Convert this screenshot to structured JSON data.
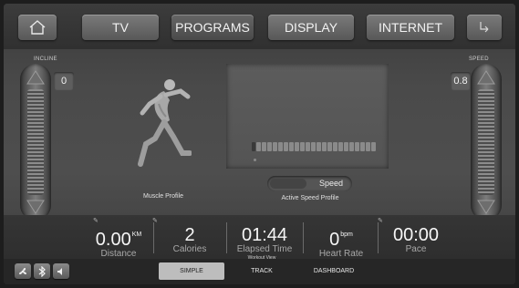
{
  "nav": {
    "tabs": [
      {
        "label": "TV"
      },
      {
        "label": "PROGRAMS"
      },
      {
        "label": "DISPLAY"
      },
      {
        "label": "INTERNET"
      }
    ],
    "home_icon": "home-icon",
    "back_icon": "back-arrow-icon"
  },
  "incline": {
    "label": "INCLINE",
    "value": "0"
  },
  "speed": {
    "label": "SPEED",
    "value": "0.8"
  },
  "muscle_profile": {
    "label": "Muscle Profile"
  },
  "speed_profile": {
    "label": "Active Speed Profile",
    "toggle_label": "Speed",
    "bar_count": 23
  },
  "stats": {
    "distance": {
      "value": "0.00",
      "unit": "KM",
      "label": "Distance"
    },
    "calories": {
      "value": "2",
      "label": "Calories"
    },
    "elapsed": {
      "value": "01:44",
      "label": "Elapsed Time"
    },
    "heart_rate": {
      "value": "0",
      "unit": "bpm",
      "label": "Heart Rate"
    },
    "pace": {
      "value": "00:00",
      "label": "Pace"
    }
  },
  "workout_view": {
    "label": "Workout View",
    "tabs": [
      {
        "label": "SIMPLE",
        "active": true
      },
      {
        "label": "TRACK",
        "active": false
      },
      {
        "label": "DASHBOARD",
        "active": false
      }
    ]
  },
  "bottom_icons": [
    "fan-icon",
    "bluetooth-icon",
    "volume-icon"
  ],
  "colors": {
    "background": "#4a4a4a",
    "active_tab": "#bdbdbd",
    "button": "#6a6a6a"
  }
}
